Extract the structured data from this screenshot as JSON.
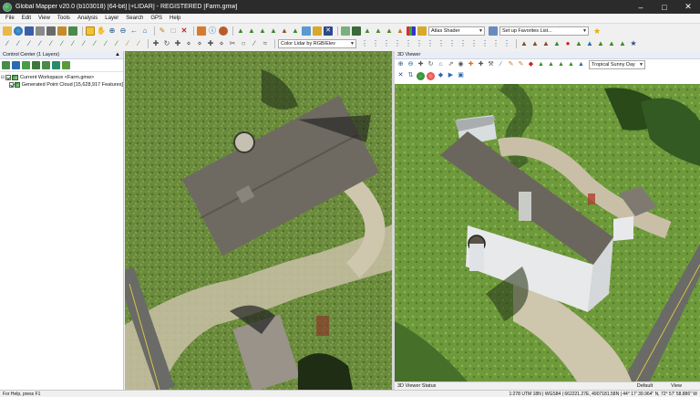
{
  "window": {
    "title": "Global Mapper v20.0 (b103018) [64-bit] [+LIDAR] - REGISTERED [Farm.gmw]"
  },
  "menu": [
    "File",
    "Edit",
    "View",
    "Tools",
    "Analysis",
    "Layer",
    "Search",
    "GPS",
    "Help"
  ],
  "toolbar": {
    "shader_combo": "Atlas Shader",
    "favorites_combo": "Set up Favorites List...",
    "lidar_color_combo": "Color Lidar by RGB/Elev"
  },
  "control_center": {
    "title": "Control Center (1 Layers)",
    "workspace_label": "Current Workspace <Farm.gmw>",
    "layer_label": "Generated Point Cloud [15,628,917 Features]"
  },
  "viewer3d": {
    "title": "3D Viewer",
    "sky_combo": "Tropical Sunny Day",
    "status_label": "3D Viewer Status",
    "status_right_1": "Default",
    "status_right_2": "View"
  },
  "statusbar": {
    "help_text": "For Help, press F1",
    "coords_text": "1:278   UTM 18N | WGS84 | 662221.27E, 4907181.58N | 44° 17' 39.964\" N, 72° 57' 58.886\" W"
  },
  "colors": {
    "titlebar": "#2b2b2b",
    "panel_header": "#e9eef6",
    "grass": "#5f7d3a",
    "roof": "#6e6a62"
  }
}
